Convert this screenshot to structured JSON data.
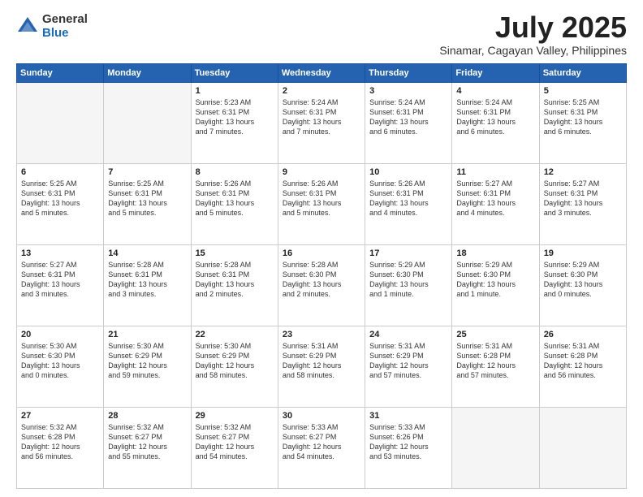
{
  "logo": {
    "general": "General",
    "blue": "Blue"
  },
  "title": "July 2025",
  "location": "Sinamar, Cagayan Valley, Philippines",
  "days_of_week": [
    "Sunday",
    "Monday",
    "Tuesday",
    "Wednesday",
    "Thursday",
    "Friday",
    "Saturday"
  ],
  "weeks": [
    [
      {
        "day": "",
        "text": ""
      },
      {
        "day": "",
        "text": ""
      },
      {
        "day": "1",
        "text": "Sunrise: 5:23 AM\nSunset: 6:31 PM\nDaylight: 13 hours\nand 7 minutes."
      },
      {
        "day": "2",
        "text": "Sunrise: 5:24 AM\nSunset: 6:31 PM\nDaylight: 13 hours\nand 7 minutes."
      },
      {
        "day": "3",
        "text": "Sunrise: 5:24 AM\nSunset: 6:31 PM\nDaylight: 13 hours\nand 6 minutes."
      },
      {
        "day": "4",
        "text": "Sunrise: 5:24 AM\nSunset: 6:31 PM\nDaylight: 13 hours\nand 6 minutes."
      },
      {
        "day": "5",
        "text": "Sunrise: 5:25 AM\nSunset: 6:31 PM\nDaylight: 13 hours\nand 6 minutes."
      }
    ],
    [
      {
        "day": "6",
        "text": "Sunrise: 5:25 AM\nSunset: 6:31 PM\nDaylight: 13 hours\nand 5 minutes."
      },
      {
        "day": "7",
        "text": "Sunrise: 5:25 AM\nSunset: 6:31 PM\nDaylight: 13 hours\nand 5 minutes."
      },
      {
        "day": "8",
        "text": "Sunrise: 5:26 AM\nSunset: 6:31 PM\nDaylight: 13 hours\nand 5 minutes."
      },
      {
        "day": "9",
        "text": "Sunrise: 5:26 AM\nSunset: 6:31 PM\nDaylight: 13 hours\nand 5 minutes."
      },
      {
        "day": "10",
        "text": "Sunrise: 5:26 AM\nSunset: 6:31 PM\nDaylight: 13 hours\nand 4 minutes."
      },
      {
        "day": "11",
        "text": "Sunrise: 5:27 AM\nSunset: 6:31 PM\nDaylight: 13 hours\nand 4 minutes."
      },
      {
        "day": "12",
        "text": "Sunrise: 5:27 AM\nSunset: 6:31 PM\nDaylight: 13 hours\nand 3 minutes."
      }
    ],
    [
      {
        "day": "13",
        "text": "Sunrise: 5:27 AM\nSunset: 6:31 PM\nDaylight: 13 hours\nand 3 minutes."
      },
      {
        "day": "14",
        "text": "Sunrise: 5:28 AM\nSunset: 6:31 PM\nDaylight: 13 hours\nand 3 minutes."
      },
      {
        "day": "15",
        "text": "Sunrise: 5:28 AM\nSunset: 6:31 PM\nDaylight: 13 hours\nand 2 minutes."
      },
      {
        "day": "16",
        "text": "Sunrise: 5:28 AM\nSunset: 6:30 PM\nDaylight: 13 hours\nand 2 minutes."
      },
      {
        "day": "17",
        "text": "Sunrise: 5:29 AM\nSunset: 6:30 PM\nDaylight: 13 hours\nand 1 minute."
      },
      {
        "day": "18",
        "text": "Sunrise: 5:29 AM\nSunset: 6:30 PM\nDaylight: 13 hours\nand 1 minute."
      },
      {
        "day": "19",
        "text": "Sunrise: 5:29 AM\nSunset: 6:30 PM\nDaylight: 13 hours\nand 0 minutes."
      }
    ],
    [
      {
        "day": "20",
        "text": "Sunrise: 5:30 AM\nSunset: 6:30 PM\nDaylight: 13 hours\nand 0 minutes."
      },
      {
        "day": "21",
        "text": "Sunrise: 5:30 AM\nSunset: 6:29 PM\nDaylight: 12 hours\nand 59 minutes."
      },
      {
        "day": "22",
        "text": "Sunrise: 5:30 AM\nSunset: 6:29 PM\nDaylight: 12 hours\nand 58 minutes."
      },
      {
        "day": "23",
        "text": "Sunrise: 5:31 AM\nSunset: 6:29 PM\nDaylight: 12 hours\nand 58 minutes."
      },
      {
        "day": "24",
        "text": "Sunrise: 5:31 AM\nSunset: 6:29 PM\nDaylight: 12 hours\nand 57 minutes."
      },
      {
        "day": "25",
        "text": "Sunrise: 5:31 AM\nSunset: 6:28 PM\nDaylight: 12 hours\nand 57 minutes."
      },
      {
        "day": "26",
        "text": "Sunrise: 5:31 AM\nSunset: 6:28 PM\nDaylight: 12 hours\nand 56 minutes."
      }
    ],
    [
      {
        "day": "27",
        "text": "Sunrise: 5:32 AM\nSunset: 6:28 PM\nDaylight: 12 hours\nand 56 minutes."
      },
      {
        "day": "28",
        "text": "Sunrise: 5:32 AM\nSunset: 6:27 PM\nDaylight: 12 hours\nand 55 minutes."
      },
      {
        "day": "29",
        "text": "Sunrise: 5:32 AM\nSunset: 6:27 PM\nDaylight: 12 hours\nand 54 minutes."
      },
      {
        "day": "30",
        "text": "Sunrise: 5:33 AM\nSunset: 6:27 PM\nDaylight: 12 hours\nand 54 minutes."
      },
      {
        "day": "31",
        "text": "Sunrise: 5:33 AM\nSunset: 6:26 PM\nDaylight: 12 hours\nand 53 minutes."
      },
      {
        "day": "",
        "text": ""
      },
      {
        "day": "",
        "text": ""
      }
    ]
  ]
}
